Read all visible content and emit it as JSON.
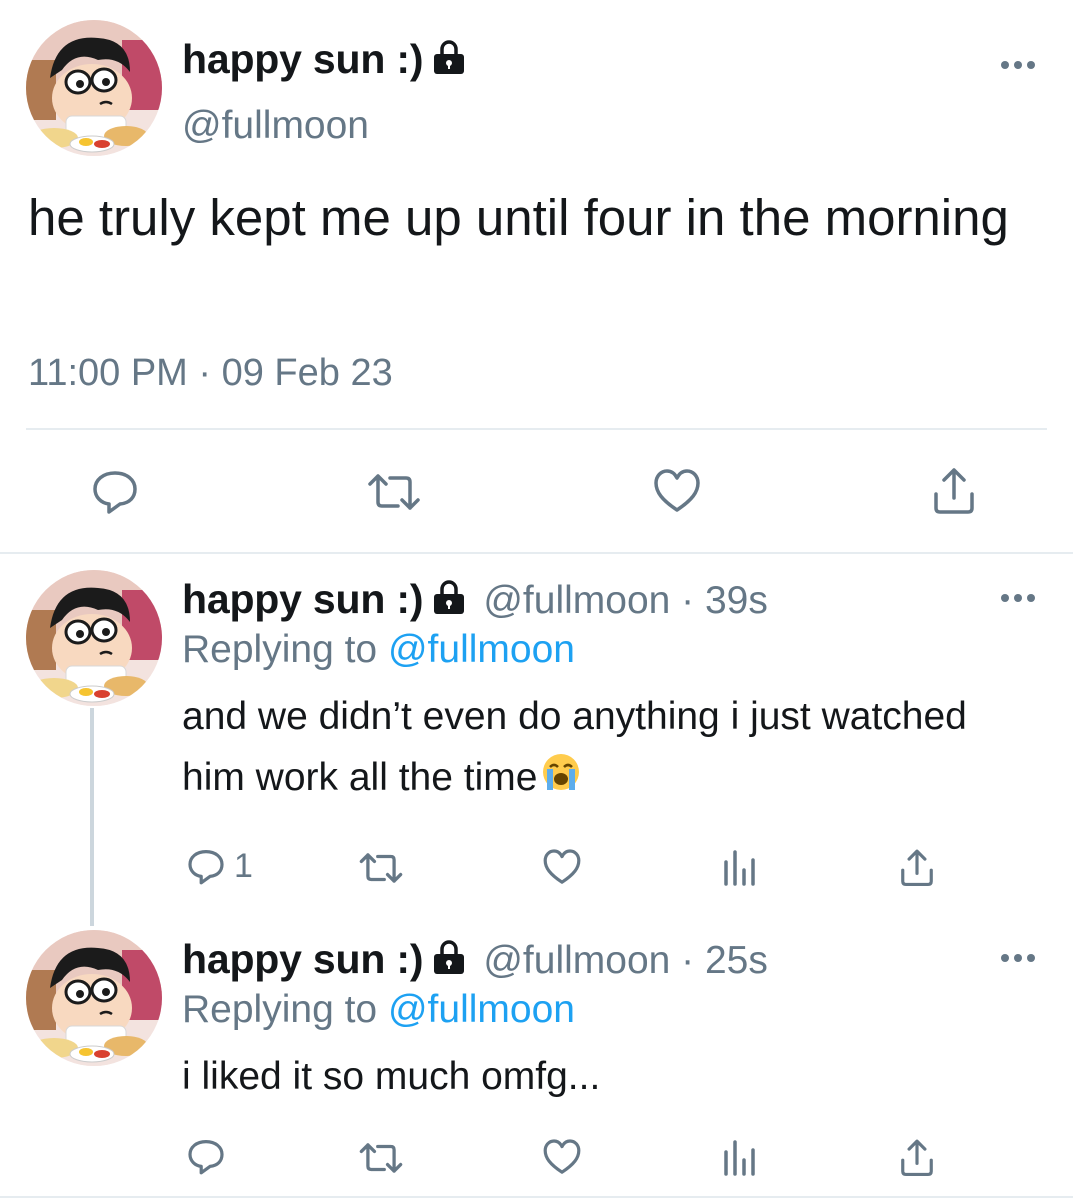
{
  "main_tweet": {
    "display_name": "happy sun :)",
    "handle": "@fullmoon",
    "text": "he truly kept me up until four in the morning",
    "timestamp": "11:00 PM · 09 Feb 23",
    "icons": [
      "lock-icon",
      "more-icon",
      "reply-icon",
      "retweet-icon",
      "like-icon",
      "share-icon"
    ]
  },
  "replies": [
    {
      "display_name": "happy sun :)",
      "handle_time": "@fullmoon · 39s",
      "replying_prefix": "Replying to ",
      "replying_mention": "@fullmoon",
      "text": "and we didn’t even do anything i just watched him work all the time",
      "emoji": "loudly-crying-face-emoji",
      "reply_count": "1"
    },
    {
      "display_name": "happy sun :)",
      "handle_time": "@fullmoon · 25s",
      "replying_prefix": "Replying to ",
      "replying_mention": "@fullmoon",
      "text": "i liked it so much omfg...",
      "reply_count": ""
    }
  ],
  "colors": {
    "text": "#14171a",
    "secondary": "#657786",
    "accent": "#1da1f2",
    "divider": "#e6ecf0"
  }
}
